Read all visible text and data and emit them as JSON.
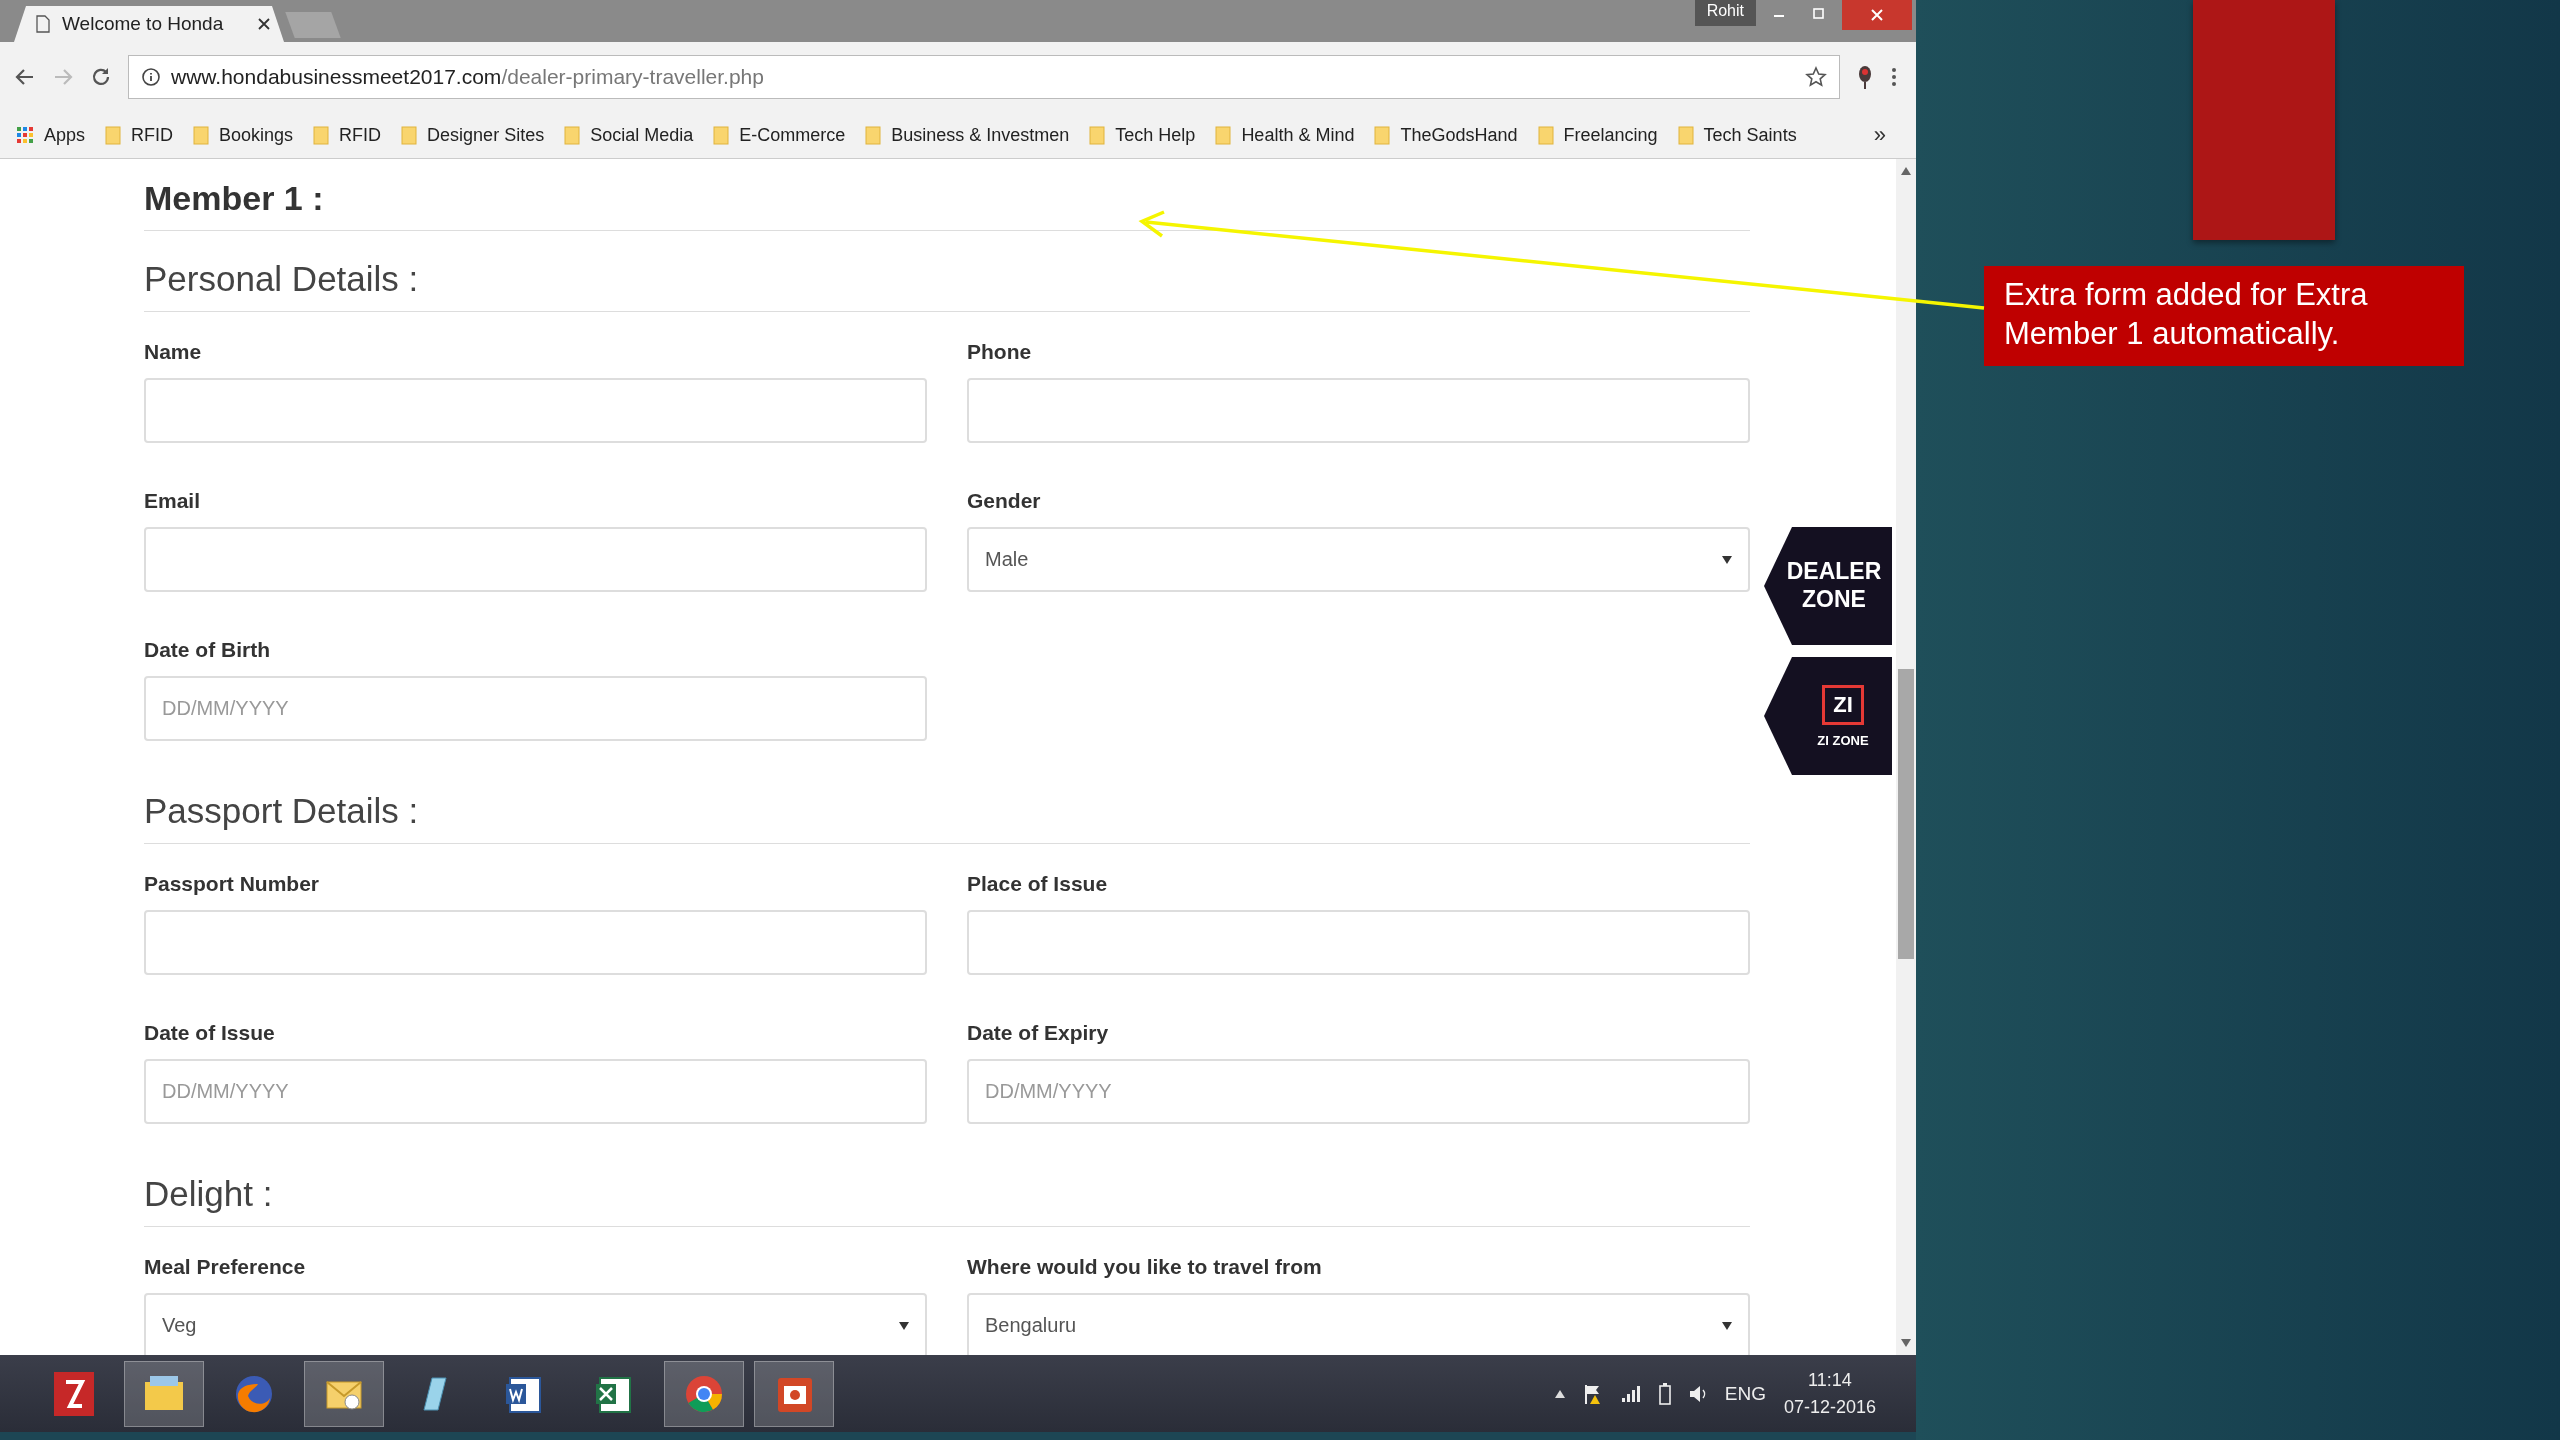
{
  "browser": {
    "tab_title": "Welcome to Honda",
    "profile": "Rohit",
    "url": {
      "domain": "www.hondabusinessmeet2017.com",
      "path": "/dealer-primary-traveller.php"
    },
    "bookmarks": {
      "apps": "Apps",
      "folders": [
        "RFID",
        "Bookings",
        "RFID",
        "Designer Sites",
        "Social Media",
        "E-Commerce",
        "Business & Investmen",
        "Tech Help",
        "Health & Mind",
        "TheGodsHand",
        "Freelancing",
        "Tech Saints"
      ],
      "more": "»"
    }
  },
  "form": {
    "title": "Member 1 :",
    "sections": [
      {
        "heading": "Personal Details :",
        "fields": [
          {
            "label": "Name",
            "kind": "text"
          },
          {
            "label": "Phone",
            "kind": "text"
          },
          {
            "label": "Email",
            "kind": "text"
          },
          {
            "label": "Gender",
            "kind": "select",
            "value": "Male"
          },
          {
            "label": "Date of Birth",
            "kind": "text",
            "placeholder": "DD/MM/YYYY"
          }
        ]
      },
      {
        "heading": "Passport Details :",
        "fields": [
          {
            "label": "Passport Number",
            "kind": "text"
          },
          {
            "label": "Place of Issue",
            "kind": "text"
          },
          {
            "label": "Date of Issue",
            "kind": "text",
            "placeholder": "DD/MM/YYYY"
          },
          {
            "label": "Date of Expiry",
            "kind": "text",
            "placeholder": "DD/MM/YYYY"
          }
        ]
      },
      {
        "heading": "Delight :",
        "fields": [
          {
            "label": "Meal Preference",
            "kind": "select",
            "value": "Veg"
          },
          {
            "label": "Where would you like to travel from",
            "kind": "select",
            "value": "Bengaluru"
          }
        ]
      }
    ]
  },
  "side_tabs": {
    "dealer_zone": "DEALER ZONE",
    "zi_logo": "ZI",
    "zi_caption": "ZI ZONE"
  },
  "taskbar": {
    "apps": [
      {
        "kind": "filezilla",
        "active": false
      },
      {
        "kind": "explorer",
        "active": true
      },
      {
        "kind": "firefox",
        "active": false
      },
      {
        "kind": "outlook",
        "active": true
      },
      {
        "kind": "notes",
        "active": false
      },
      {
        "kind": "word",
        "active": false
      },
      {
        "kind": "excel",
        "active": false
      },
      {
        "kind": "chrome",
        "active": true
      },
      {
        "kind": "powerpoint",
        "active": true
      }
    ],
    "language": "ENG",
    "time": "11:14",
    "date": "07-12-2016"
  },
  "slide": {
    "callout": "Extra form added for Extra Member 1 automatically."
  }
}
